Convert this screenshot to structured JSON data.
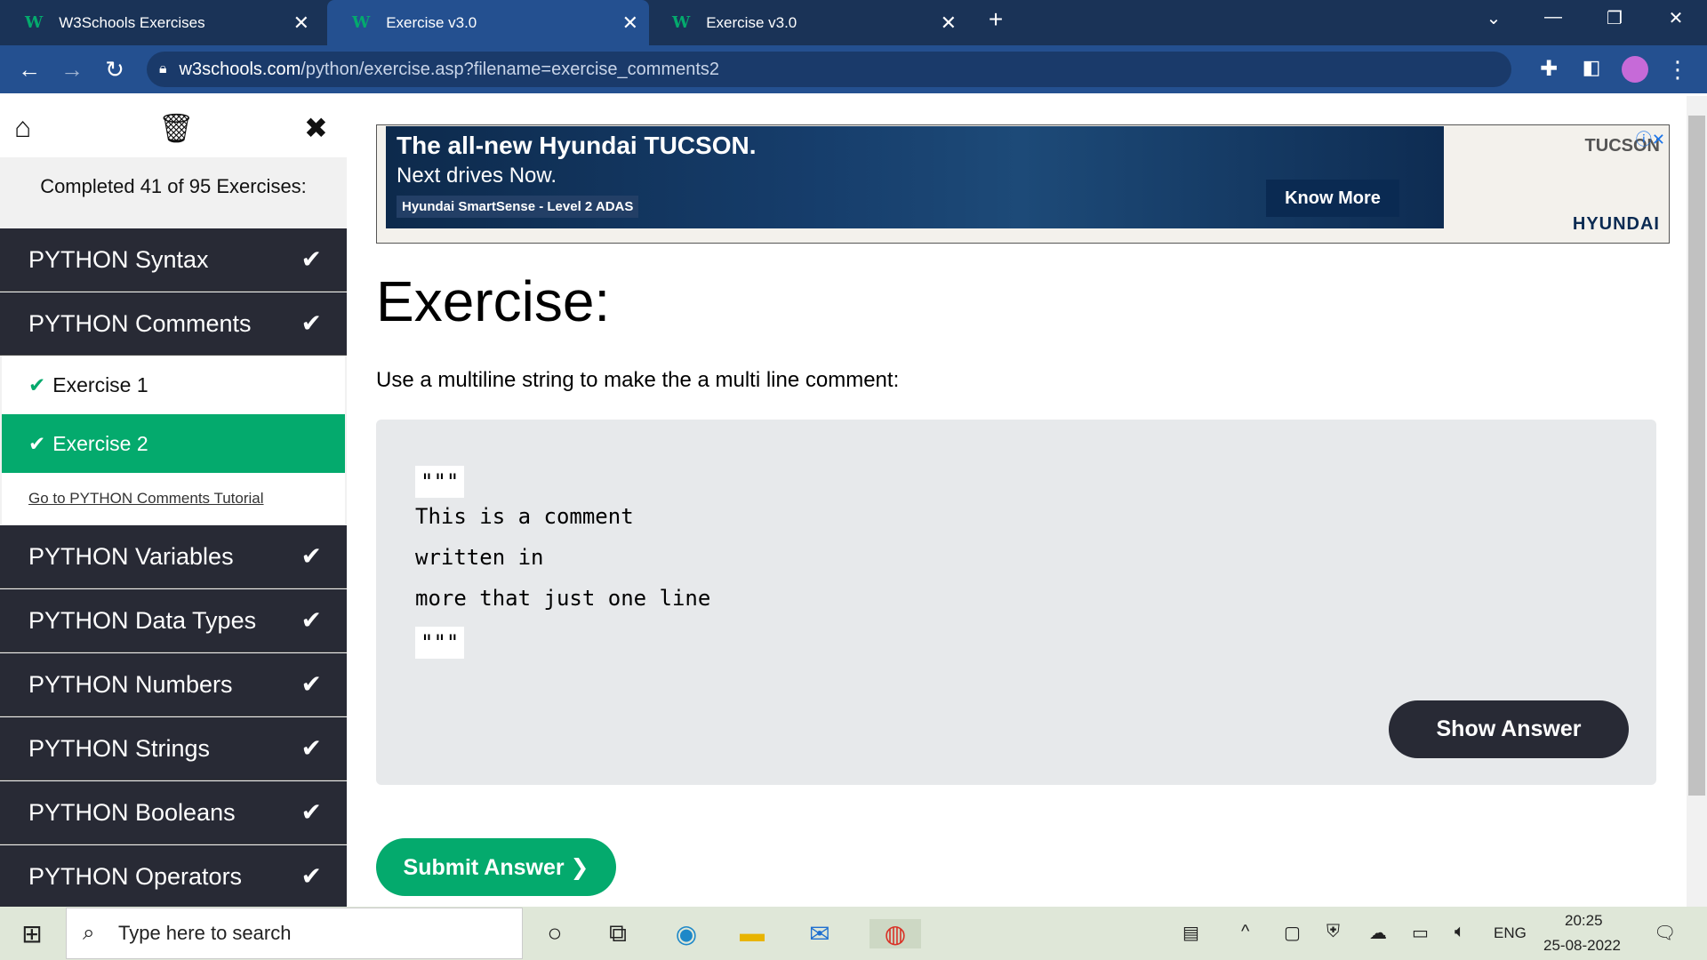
{
  "browser": {
    "tabs": [
      {
        "label": "W3Schools Exercises",
        "active": false
      },
      {
        "label": "Exercise v3.0",
        "active": true
      },
      {
        "label": "Exercise v3.0",
        "active": false
      }
    ],
    "tab_icon": "W",
    "url_host": "w3schools.com",
    "url_path": "/python/exercise.asp?filename=exercise_comments2"
  },
  "sidebar": {
    "completed_text": "Completed 41 of 95 Exercises:",
    "categories": [
      {
        "label": "PYTHON Syntax",
        "done": true
      },
      {
        "label": "PYTHON Comments",
        "done": true
      },
      {
        "label": "PYTHON Variables",
        "done": true
      },
      {
        "label": "PYTHON Data Types",
        "done": true
      },
      {
        "label": "PYTHON Numbers",
        "done": true
      },
      {
        "label": "PYTHON Strings",
        "done": true
      },
      {
        "label": "PYTHON Booleans",
        "done": true
      },
      {
        "label": "PYTHON Operators",
        "done": true
      }
    ],
    "exercises": [
      {
        "label": "Exercise 1",
        "selected": false
      },
      {
        "label": "Exercise 2",
        "selected": true
      }
    ],
    "tutorial_link": "Go to PYTHON Comments Tutorial"
  },
  "ad": {
    "headline": "The all-new Hyundai TUCSON.",
    "subline": "Next drives Now.",
    "feature": "Hyundai SmartSense - Level 2 ADAS",
    "button": "Know More",
    "model": "TUCSON",
    "brand": "HYUNDAI"
  },
  "exercise": {
    "title": "Exercise:",
    "instruction": "Use a multiline string to make the a multi line comment:",
    "code_lines": [
      "\"\"\"",
      "This is a comment",
      "written in",
      "more that just one line",
      "\"\"\""
    ],
    "show_answer": "Show Answer",
    "submit": "Submit Answer ❯"
  },
  "taskbar": {
    "search_placeholder": "Type here to search",
    "lang": "ENG",
    "time": "20:25",
    "date": "25-08-2022"
  },
  "colors": {
    "accent": "#04aa6d",
    "dark": "#282a35",
    "chrome": "#245090"
  }
}
